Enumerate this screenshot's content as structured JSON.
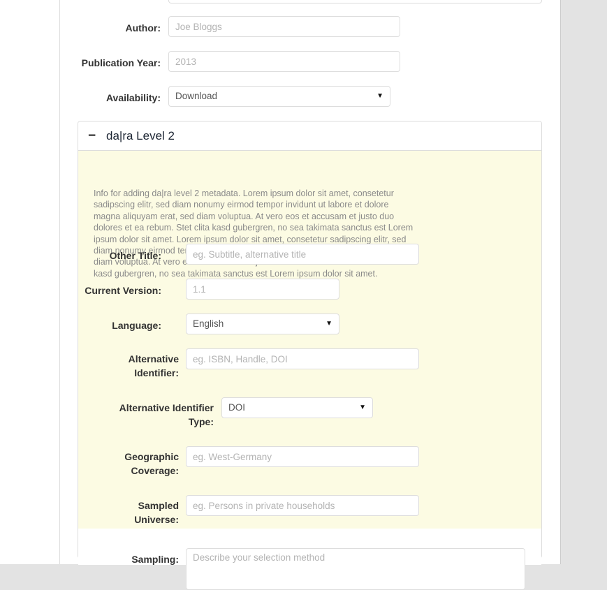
{
  "page": {
    "background_color": "#e3e3e3",
    "content_background": "#ffffff"
  },
  "top_fields": [
    {
      "name": "author",
      "label": "Author:",
      "type": "text",
      "value": "",
      "placeholder": "Joe Bloggs"
    },
    {
      "name": "publication-year",
      "label": "Publication Year:",
      "type": "text",
      "value": "",
      "placeholder": "2013"
    },
    {
      "name": "availability",
      "label": "Availability:",
      "type": "select",
      "value": "Download",
      "caret": "▼"
    }
  ],
  "panel": {
    "toggle_icon": "−",
    "toggle_icon_name": "minus-collapse-icon",
    "title": "da|ra Level 2",
    "background_color": "#fcfbe3",
    "info_text": "Info for adding da|ra level 2 metadata. Lorem ipsum dolor sit amet, consetetur sadipscing elitr, sed diam nonumy eirmod tempor invidunt ut labore et dolore magna aliquyam erat, sed diam voluptua. At vero eos et accusam et justo duo dolores et ea rebum. Stet clita kasd gubergren, no sea takimata sanctus est Lorem ipsum dolor sit amet. Lorem ipsum dolor sit amet, consetetur sadipscing elitr, sed diam nonumy eirmod tempor invidunt ut labore et dolore magna aliquyam erat, sed diam voluptua. At vero eos et accusam et justo duo dolores et ea rebum. Stet clita kasd gubergren, no sea takimata sanctus est Lorem ipsum dolor sit amet.",
    "fields": [
      {
        "name": "other-title",
        "label": "Other Title:",
        "type": "text",
        "value": "",
        "placeholder": "eg. Subtitle, alternative title"
      },
      {
        "name": "current-version",
        "label": "Current Version:",
        "type": "text",
        "value": "",
        "placeholder": "1.1"
      },
      {
        "name": "language",
        "label": "Language:",
        "type": "select",
        "value": "English",
        "caret": "▼"
      },
      {
        "name": "alternative-identifier",
        "label": "Alternative Identifier:",
        "type": "text",
        "value": "",
        "placeholder": "eg. ISBN, Handle, DOI"
      },
      {
        "name": "alternative-identifier-type",
        "label": "Alternative Identifier Type:",
        "type": "select",
        "value": "DOI",
        "caret": "▼"
      },
      {
        "name": "geographic-coverage",
        "label": "Geographic Coverage:",
        "type": "text",
        "value": "",
        "placeholder": "eg. West-Germany"
      },
      {
        "name": "sampled-universe",
        "label": "Sampled Universe:",
        "type": "text",
        "value": "",
        "placeholder": "eg. Persons in private households"
      },
      {
        "name": "sampling",
        "label": "Sampling:",
        "type": "textarea",
        "value": "",
        "placeholder": "Describe your selection method"
      }
    ]
  }
}
